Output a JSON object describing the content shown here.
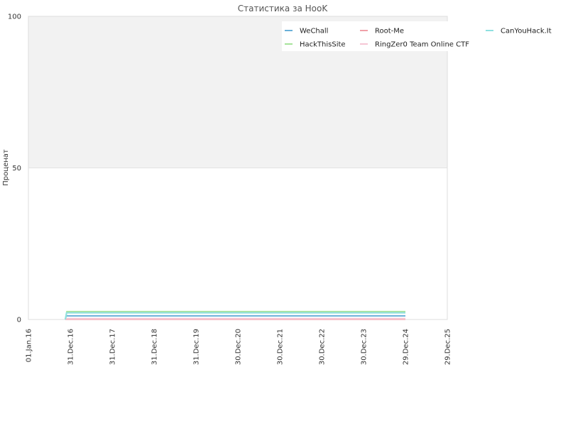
{
  "chart_data": {
    "type": "line",
    "title": "Статистика за HooK",
    "xlabel": "",
    "ylabel": "Проценат",
    "x_ticks": [
      "01.Jan.16",
      "31.Dec.16",
      "31.Dec.17",
      "31.Dec.18",
      "31.Dec.19",
      "30.Dec.20",
      "30.Dec.21",
      "30.Dec.22",
      "30.Dec.23",
      "29.Dec.24",
      "29.Dec.25"
    ],
    "y_ticks": [
      0,
      50,
      100
    ],
    "xlim": [
      "2016-01-01",
      "2025-12-29"
    ],
    "ylim": [
      0,
      100
    ],
    "grid": true,
    "legend_position": "top-right",
    "series": [
      {
        "name": "WeChall",
        "color": "#6ab0d9",
        "x": [
          "2016-11-18",
          "2016-11-25",
          "2024-12-29"
        ],
        "values": [
          0,
          1.2,
          1.2
        ]
      },
      {
        "name": "HackThisSite",
        "color": "#a6e39a",
        "x": [
          "2016-11-18",
          "2016-12-01",
          "2024-12-29"
        ],
        "values": [
          0,
          2.6,
          2.6
        ]
      },
      {
        "name": "Root-Me",
        "color": "#f0a0a8",
        "x": [
          "2016-11-18",
          "2024-12-29"
        ],
        "values": [
          0.1,
          0.1
        ]
      },
      {
        "name": "RingZer0 Team Online CTF",
        "color": "#f6c6d4",
        "x": [
          "2016-11-18",
          "2024-12-29"
        ],
        "values": [
          0.3,
          0.3
        ]
      },
      {
        "name": "CanYouHack.It",
        "color": "#8fe0e0",
        "x": [
          "2016-11-18",
          "2016-11-28",
          "2024-12-29"
        ],
        "values": [
          0,
          2.2,
          2.2
        ]
      }
    ]
  }
}
